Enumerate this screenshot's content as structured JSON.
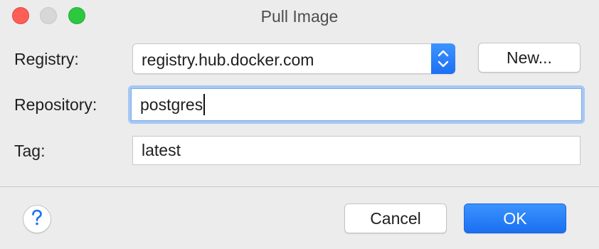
{
  "window": {
    "title": "Pull Image"
  },
  "form": {
    "registry_label": "Registry:",
    "registry_value": "registry.hub.docker.com",
    "new_button_label": "New...",
    "repository_label": "Repository:",
    "repository_value": "postgres",
    "tag_label": "Tag:",
    "tag_value": "latest"
  },
  "footer": {
    "help_icon": "question-mark-icon",
    "cancel_label": "Cancel",
    "ok_label": "OK"
  },
  "colors": {
    "accent": "#1d6ff2",
    "close": "#fd5f57",
    "minimize": "#d7d7d7",
    "maximize": "#2bc840",
    "focus_ring": "#a6c8f5"
  }
}
